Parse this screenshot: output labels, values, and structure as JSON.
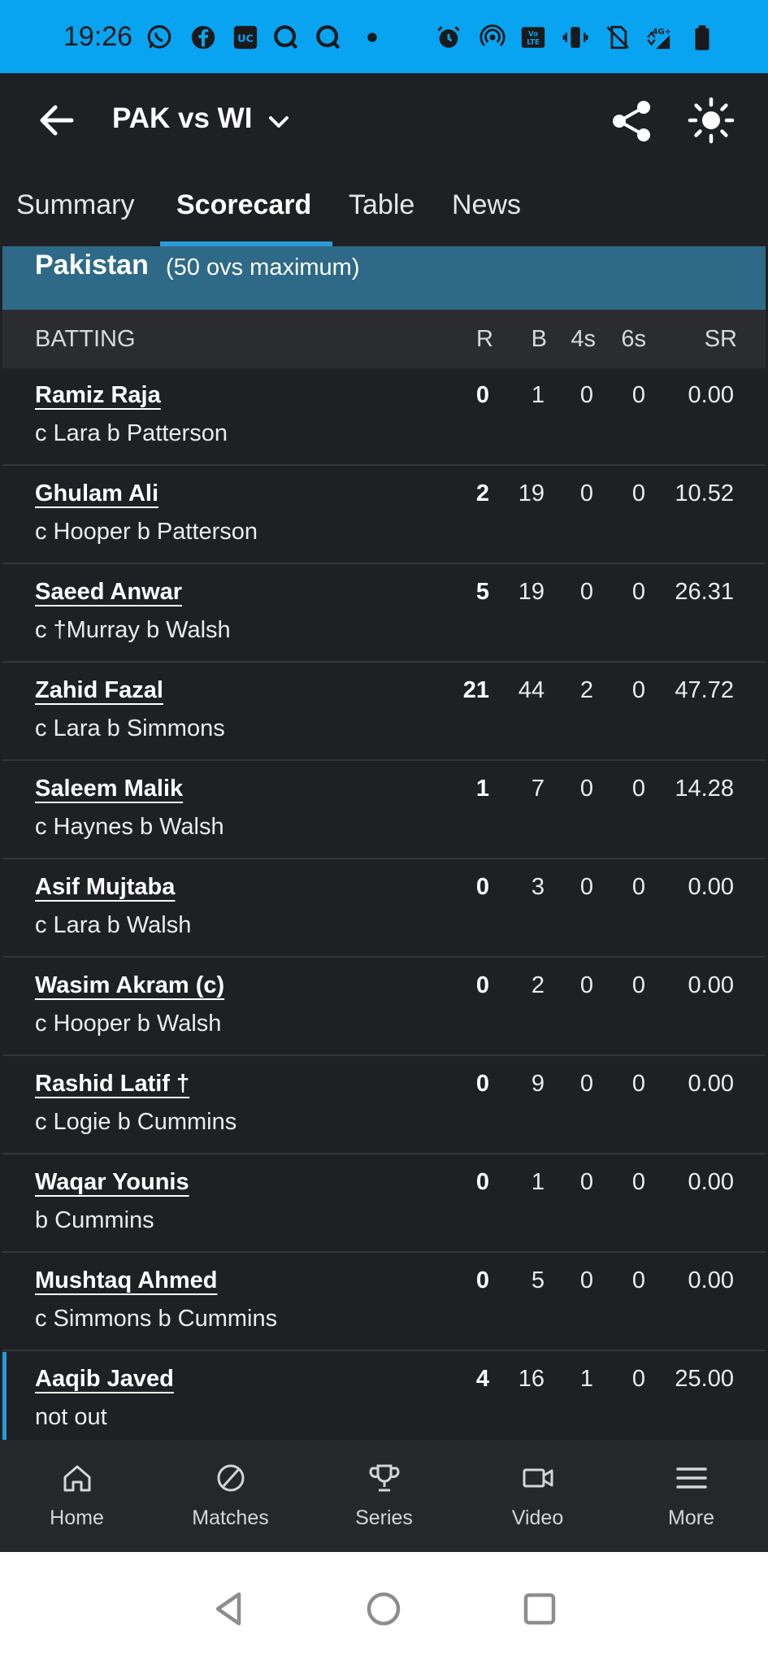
{
  "status_bar": {
    "time": "19:26",
    "left_icons": [
      "whatsapp-icon",
      "facebook-icon",
      "uc-browser-icon",
      "qapp-icon",
      "qapp-icon",
      "dot-icon"
    ],
    "right_icons": [
      "alarm-icon",
      "hotspot-icon",
      "volte-icon",
      "vibrate-icon",
      "no-sim-icon",
      "network-4g-icon",
      "battery-icon"
    ]
  },
  "app_bar": {
    "title": "PAK vs WI"
  },
  "tabs": [
    {
      "label": "Summary",
      "active": false
    },
    {
      "label": "Scorecard",
      "active": true
    },
    {
      "label": "Table",
      "active": false
    },
    {
      "label": "News",
      "active": false
    }
  ],
  "innings": {
    "team": "Pakistan",
    "overs_info": "(50 ovs maximum)"
  },
  "columns": {
    "batting": "BATTING",
    "runs": "R",
    "balls": "B",
    "fours": "4s",
    "sixes": "6s",
    "strike_rate": "SR"
  },
  "batters": [
    {
      "name": "Ramiz Raja",
      "dismissal": "c Lara b Patterson",
      "r": "0",
      "b": "1",
      "fours": "0",
      "sixes": "0",
      "sr": "0.00"
    },
    {
      "name": "Ghulam Ali",
      "dismissal": "c Hooper b Patterson",
      "r": "2",
      "b": "19",
      "fours": "0",
      "sixes": "0",
      "sr": "10.52"
    },
    {
      "name": "Saeed Anwar",
      "dismissal": "c †Murray b Walsh",
      "r": "5",
      "b": "19",
      "fours": "0",
      "sixes": "0",
      "sr": "26.31"
    },
    {
      "name": "Zahid Fazal",
      "dismissal": "c Lara b Simmons",
      "r": "21",
      "b": "44",
      "fours": "2",
      "sixes": "0",
      "sr": "47.72"
    },
    {
      "name": "Saleem Malik",
      "dismissal": "c Haynes b Walsh",
      "r": "1",
      "b": "7",
      "fours": "0",
      "sixes": "0",
      "sr": "14.28"
    },
    {
      "name": "Asif Mujtaba",
      "dismissal": "c Lara b Walsh",
      "r": "0",
      "b": "3",
      "fours": "0",
      "sixes": "0",
      "sr": "0.00"
    },
    {
      "name": "Wasim Akram (c)",
      "dismissal": "c Hooper b Walsh",
      "r": "0",
      "b": "2",
      "fours": "0",
      "sixes": "0",
      "sr": "0.00"
    },
    {
      "name": "Rashid Latif †",
      "dismissal": "c Logie b Cummins",
      "r": "0",
      "b": "9",
      "fours": "0",
      "sixes": "0",
      "sr": "0.00"
    },
    {
      "name": "Waqar Younis",
      "dismissal": "b Cummins",
      "r": "0",
      "b": "1",
      "fours": "0",
      "sixes": "0",
      "sr": "0.00"
    },
    {
      "name": "Mushtaq Ahmed",
      "dismissal": "c Simmons b Cummins",
      "r": "0",
      "b": "5",
      "fours": "0",
      "sixes": "0",
      "sr": "0.00"
    },
    {
      "name": "Aaqib Javed",
      "dismissal": "not out",
      "r": "4",
      "b": "16",
      "fours": "1",
      "sixes": "0",
      "sr": "25.00",
      "current": true
    }
  ],
  "bottom_nav": [
    {
      "label": "Home",
      "icon": "home-icon"
    },
    {
      "label": "Matches",
      "icon": "cricket-ball-icon"
    },
    {
      "label": "Series",
      "icon": "trophy-icon"
    },
    {
      "label": "Video",
      "icon": "video-camera-icon"
    },
    {
      "label": "More",
      "icon": "menu-icon"
    }
  ],
  "colors": {
    "status_bar": "#08a4f2",
    "background": "#1f2023",
    "innings_header": "#2e6a87",
    "accent": "#2a9bd8"
  }
}
